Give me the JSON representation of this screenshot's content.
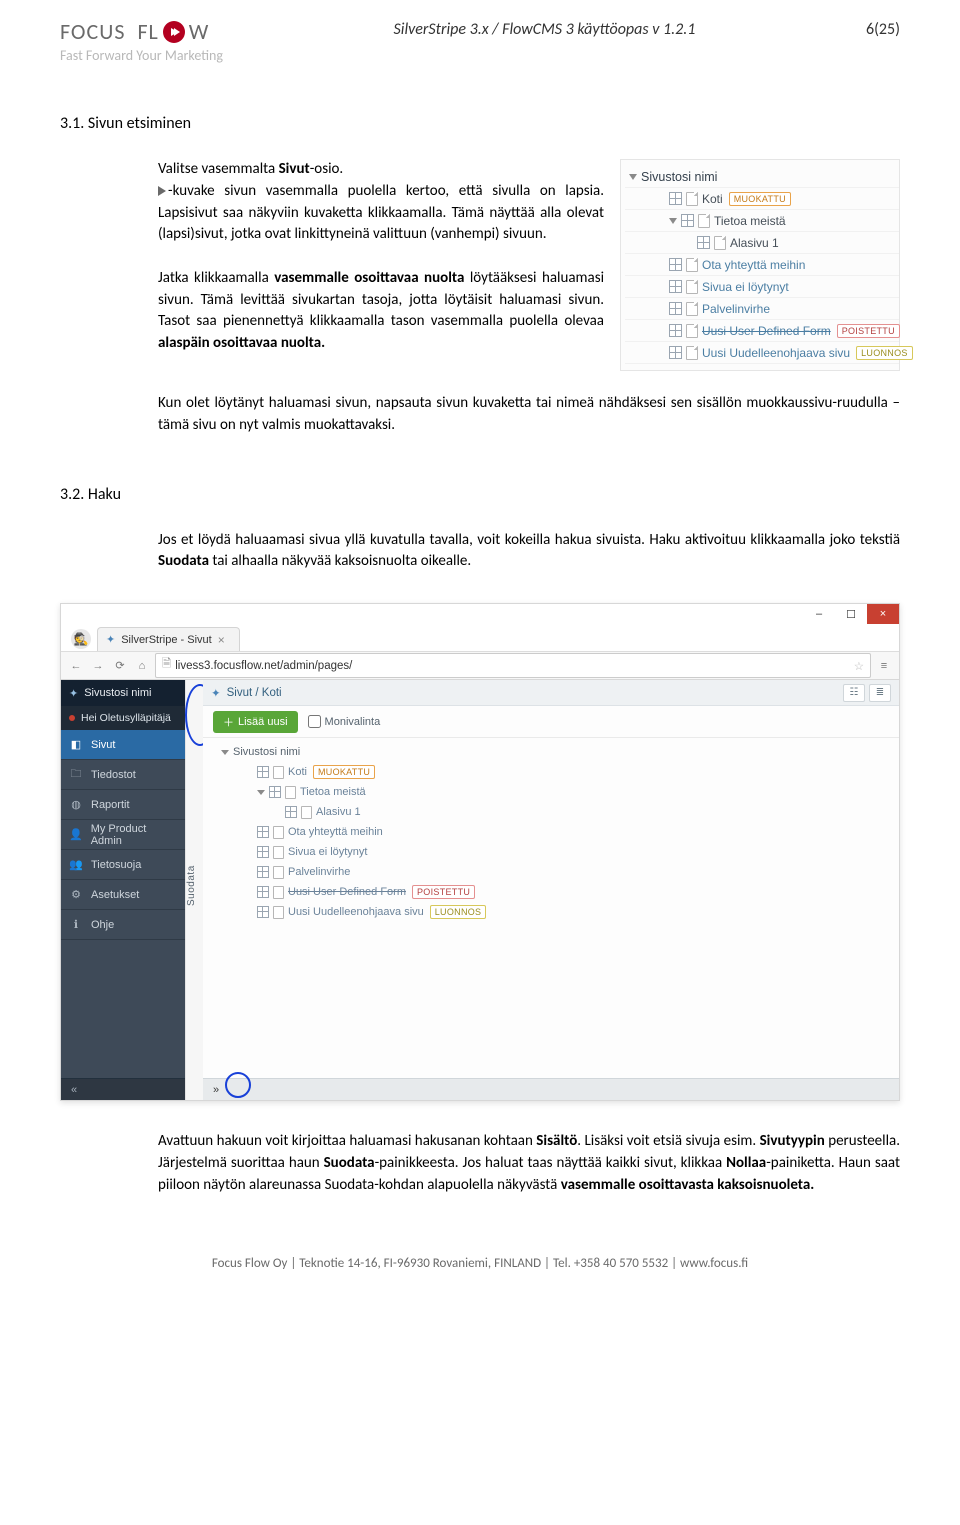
{
  "header": {
    "logo_a": "FOCUS",
    "logo_b": "FL",
    "logo_c": "W",
    "tagline": "Fast Forward Your Marketing",
    "title": "SilverStripe 3.x / FlowCMS 3 käyttöopas v 1.2.1",
    "page": "6(25)"
  },
  "section1": {
    "title": "3.1. Sivun etsiminen",
    "p1a": "Valitse vasemmalta ",
    "p1b": "Sivut",
    "p1c": "-osio.",
    "p2": "-kuvake sivun vasemmalla puolella kertoo, että sivulla on lapsia. Lapsisivut saa näkyviin kuvaketta klikkaamalla. Tämä näyttää alla olevat (lapsi)sivut, jotka ovat linkittyneinä valittuun (vanhempi) sivuun.",
    "p3a": "Jatka klikkaamalla ",
    "p3b": "vasemmalle osoittavaa nuolta",
    "p3c": " löytääksesi haluamasi sivun. Tämä levittää sivukartan tasoja, jotta löytäisit haluamasi sivun. Tasot saa pienennettyä klikkaamalla tason vasemmalla puolella olevaa ",
    "p3d": "alaspäin osoittavaa nuolta.",
    "p4": "Kun olet löytänyt haluamasi sivun, napsauta sivun kuvaketta tai nimeä nähdäksesi sen sisällön muokkaussivu-ruudulla – tämä sivu on nyt valmis muokattavaksi."
  },
  "treepanel": {
    "header": "Sivustosi nimi",
    "items": [
      {
        "indent": 2,
        "toggle": false,
        "label": "Koti",
        "badge": "MUOKATTU",
        "badgeKind": "orange",
        "link": false,
        "strike": false
      },
      {
        "indent": 2,
        "toggle": true,
        "label": "Tietoa meistä",
        "badge": null,
        "link": false,
        "strike": false
      },
      {
        "indent": 3,
        "toggle": false,
        "label": "Alasivu 1",
        "badge": null,
        "link": false,
        "strike": false
      },
      {
        "indent": 2,
        "toggle": false,
        "label": "Ota yhteyttä meihin",
        "badge": null,
        "link": true,
        "strike": false
      },
      {
        "indent": 2,
        "toggle": false,
        "label": "Sivua ei löytynyt",
        "badge": null,
        "link": true,
        "strike": false
      },
      {
        "indent": 2,
        "toggle": false,
        "label": "Palvelinvirhe",
        "badge": null,
        "link": true,
        "strike": false
      },
      {
        "indent": 2,
        "toggle": false,
        "label": "Uusi User Defined Form",
        "badge": "POISTETTU",
        "badgeKind": "red",
        "link": true,
        "strike": true
      },
      {
        "indent": 2,
        "toggle": false,
        "label": "Uusi Uudelleenohjaava sivu",
        "badge": "LUONNOS",
        "badgeKind": "yellow",
        "link": true,
        "strike": false
      }
    ]
  },
  "section2": {
    "title": "3.2. Haku",
    "p1a": "Jos et löydä haluaamasi sivua yllä kuvatulla tavalla, voit kokeilla hakua sivuista. Haku aktivoituu klikkaamalla joko tekstiä ",
    "p1b": "Suodata",
    "p1c": " tai alhaalla näkyvää kaksoisnuolta oikealle."
  },
  "browser": {
    "win": {
      "min": "–",
      "max": "☐",
      "close": "×"
    },
    "tab": "SilverStripe - Sivut",
    "url": "livess3.focusflow.net/admin/pages/",
    "suodata": "Suodata",
    "ss_icon": "✦",
    "nav": {
      "site_title": "Sivustosi nimi",
      "greeting": "Hei Oletusylläpitäjä",
      "items": [
        {
          "icon": "◧",
          "label": "Sivut",
          "active": true
        },
        {
          "icon": "🗀",
          "label": "Tiedostot",
          "active": false
        },
        {
          "icon": "◍",
          "label": "Raportit",
          "active": false
        },
        {
          "icon": "👤",
          "label": "My Product Admin",
          "active": false
        },
        {
          "icon": "👥",
          "label": "Tietosuoja",
          "active": false
        },
        {
          "icon": "⚙",
          "label": "Asetukset",
          "active": false
        },
        {
          "icon": "ℹ",
          "label": "Ohje",
          "active": false
        }
      ],
      "chev": "«"
    },
    "main": {
      "breadcrumb": "Sivut / Koti",
      "add_btn": "Lisää uusi",
      "multi": "Monivalinta",
      "tree_header": "Sivustosi nimi",
      "items": [
        {
          "indent": 3,
          "label": "Koti",
          "badge": "MUOKATTU",
          "badgeKind": "orange",
          "link": true,
          "strike": false
        },
        {
          "indent": 3,
          "toggle": true,
          "label": "Tietoa meistä",
          "link": true,
          "strike": false
        },
        {
          "indent": 4,
          "label": "Alasivu 1",
          "link": true,
          "strike": false
        },
        {
          "indent": 3,
          "label": "Ota yhteyttä meihin",
          "link": true,
          "strike": false
        },
        {
          "indent": 3,
          "label": "Sivua ei löytynyt",
          "link": true,
          "strike": false
        },
        {
          "indent": 3,
          "label": "Palvelinvirhe",
          "link": true,
          "strike": false
        },
        {
          "indent": 3,
          "label": "Uusi User Defined Form",
          "badge": "POISTETTU",
          "badgeKind": "red",
          "link": true,
          "strike": true
        },
        {
          "indent": 3,
          "label": "Uusi Uudelleenohjaava sivu",
          "badge": "LUONNOS",
          "badgeKind": "yellow",
          "link": true,
          "strike": false
        }
      ],
      "bottom_chev": "»"
    }
  },
  "section3": {
    "p1a": "Avattuun hakuun voit kirjoittaa haluamasi hakusanan kohtaan ",
    "p1b": "Sisältö",
    "p1c": ". Lisäksi voit etsiä sivuja esim. ",
    "p1d": "Sivutyypin",
    "p1e": " perusteella. Järjestelmä suorittaa haun ",
    "p1f": "Suodata",
    "p1g": "-painikkeesta. Jos haluat taas näyttää kaikki sivut, klikkaa ",
    "p1h": "Nollaa",
    "p1i": "-painiketta. Haun saat piiloon näytön alareunassa Suodata-kohdan alapuolella näkyvästä ",
    "p1j": "vasemmalle osoittavasta kaksoisnuoleta."
  },
  "footer": "Focus Flow Oy  |  Teknotie 14-16, FI-96930 Rovaniemi, FINLAND  |  Tel. +358 40 570 5532  |  www.focus.fi"
}
